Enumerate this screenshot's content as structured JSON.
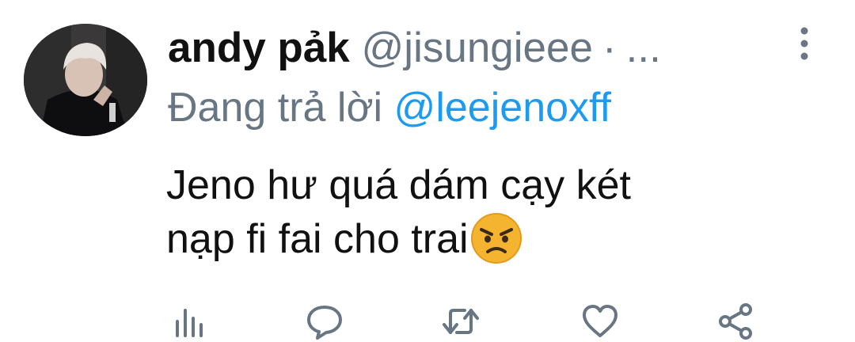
{
  "tweet": {
    "display_name": "andy pảk",
    "handle": "@jisungieee",
    "separator": "·",
    "overflow": "...",
    "reply_prefix": "Đang trả lời ",
    "reply_to": "@leejenoxff",
    "text_line1": "Jeno hư quá dám cạy két",
    "text_line2": "nạp fi fai cho trai",
    "emoji": "angry-face-emoji"
  },
  "actions": [
    "analytics-icon",
    "reply-icon",
    "retweet-icon",
    "like-icon",
    "share-icon"
  ],
  "colors": {
    "text": "#111111",
    "secondary": "#687684",
    "mention": "#1d9bf0",
    "emoji": "#f4b42f"
  }
}
